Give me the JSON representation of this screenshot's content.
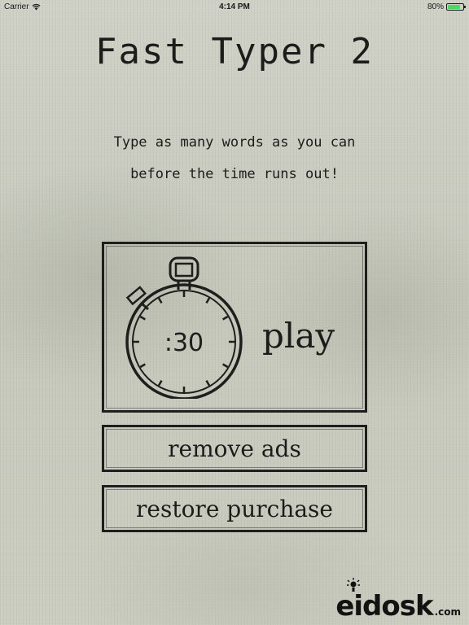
{
  "status_bar": {
    "carrier": "Carrier",
    "time": "4:14 PM",
    "battery": "80%",
    "battery_level": 0.8,
    "wifi_icon": "wifi-icon",
    "battery_icon": "battery-icon"
  },
  "title": "Fast Typer 2",
  "instructions": {
    "line1": "Type as many words as you can",
    "line2": "before the time runs out!"
  },
  "play": {
    "timer": ":30",
    "label": "play",
    "icon": "stopwatch-icon"
  },
  "buttons": {
    "remove_ads": "remove ads",
    "restore_purchase": "restore purchase"
  },
  "logo": {
    "main": "eidosk",
    "suffix": ".com",
    "icon": "lightbulb-icon"
  },
  "colors": {
    "ink": "#1e1e1c",
    "paper": "#c9cbbf",
    "battery_fill": "#4cd964"
  }
}
